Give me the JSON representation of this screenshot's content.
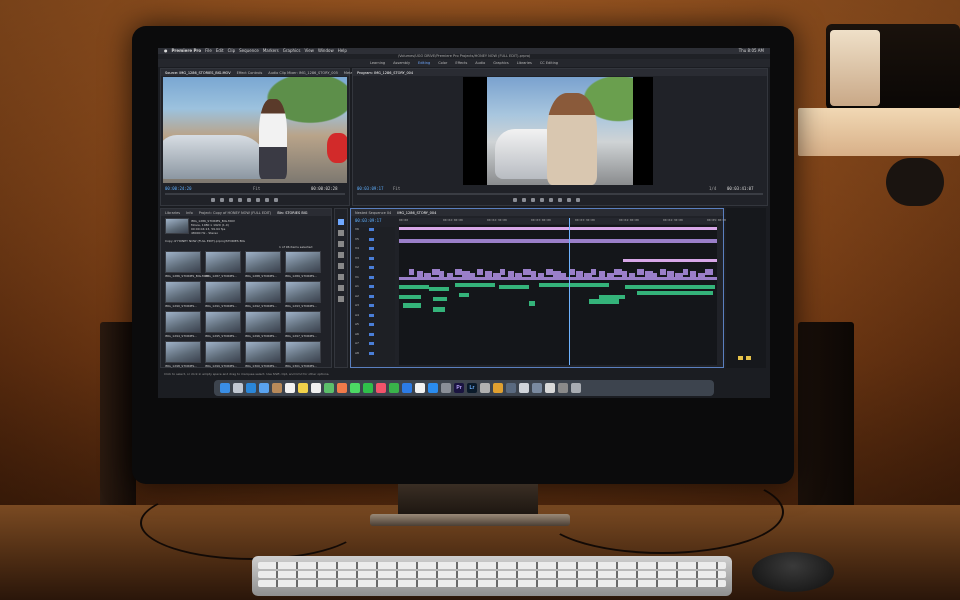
{
  "menubar": {
    "app": "Premiere Pro",
    "items": [
      "File",
      "Edit",
      "Clip",
      "Sequence",
      "Markers",
      "Graphics",
      "View",
      "Window",
      "Help"
    ],
    "clock": "Thu 8:05 AM"
  },
  "window_title": "/Volumes/UGO DRIVE/Premiere Pro Projects/HONEY NOW (FULL EDIT).prproj",
  "workspaces": {
    "items": [
      "Learning",
      "Assembly",
      "Editing",
      "Color",
      "Effects",
      "Audio",
      "Graphics",
      "Libraries",
      "CC Editing"
    ],
    "active": "Editing"
  },
  "source_monitor": {
    "tabs": [
      "Source: IMG_1286_STORIES_BIG.MOV",
      "Effect Controls",
      "Audio Clip Mixer: IMG_1286_STORY_005",
      "Metadata",
      "Audio Track M"
    ],
    "timecode_in": "00:00:24:20",
    "timecode_out": "00:00:02:28",
    "fit": "Fit"
  },
  "program_monitor": {
    "tabs": [
      "Program: IMG_1286_STORY_004"
    ],
    "timecode_in": "00:03:09:17",
    "timecode_out": "00:03:41:07",
    "fit": "Fit",
    "ratio": "1/4"
  },
  "project_panel": {
    "tabs": [
      "Libraries",
      "Info",
      "Project: Copy of HONEY NOW (FULL EDIT)",
      "Bin: STORIES BIG"
    ],
    "clip_info": [
      "IMG_1286_STORIES_BIG.MOV",
      "Movie, 1080 x 1920 (1.0)",
      "00:00:04:13, 59.94 fps",
      "48000 Hz - Stereo"
    ],
    "path": "Copy of HONEY NOW (FULL EDIT).prproj/STORIES BIG",
    "items_selected": "1 of 96 items selected",
    "thumbs": [
      "IMG_1286_STORIES_BIG.MOV",
      "IMG_1287_STORIES...",
      "IMG_1288_STORIES...",
      "IMG_1289_STORIES...",
      "IMG_1290_STORIES...",
      "IMG_1291_STORIES...",
      "IMG_1292_STORIES...",
      "IMG_1293_STORIES...",
      "IMG_1294_STORIES...",
      "IMG_1295_STORIES...",
      "IMG_1296_STORIES...",
      "IMG_1297_STORIES...",
      "IMG_1298_STORIES...",
      "IMG_1299_STORIES...",
      "IMG_1300_STORIES...",
      "IMG_1301_STORIES..."
    ]
  },
  "timeline": {
    "tabs": [
      "Nested Sequence 04",
      "IMG_1286_STORY_004"
    ],
    "timecode": "00:03:09:17",
    "ruler": [
      "00:00",
      "00:02:00:00",
      "00:02:30:00",
      "00:03:00:00",
      "00:03:30:00",
      "00:04:00:00",
      "00:04:30:00",
      "00:05:00:00"
    ],
    "tracks": [
      "V6",
      "V5",
      "V4",
      "V3",
      "V2",
      "V1",
      "A1",
      "A2",
      "A3",
      "A4",
      "A5",
      "A6",
      "A7",
      "A8"
    ]
  },
  "status_bar": "Click to select, or click in empty space and drag to marquee select. Use Shift, Opt, and Cmd for other options.",
  "dock": [
    {
      "name": "finder",
      "color": "#3a8ee6",
      "glyph": ""
    },
    {
      "name": "launchpad",
      "color": "#c0c7d2",
      "glyph": ""
    },
    {
      "name": "safari",
      "color": "#2a86d8",
      "glyph": ""
    },
    {
      "name": "mail",
      "color": "#5aa3f0",
      "glyph": ""
    },
    {
      "name": "contacts",
      "color": "#b88a5a",
      "glyph": ""
    },
    {
      "name": "calendar",
      "color": "#f2f2f2",
      "glyph": ""
    },
    {
      "name": "notes",
      "color": "#f2d24a",
      "glyph": ""
    },
    {
      "name": "reminders",
      "color": "#efefef",
      "glyph": ""
    },
    {
      "name": "maps",
      "color": "#5bbf6a",
      "glyph": ""
    },
    {
      "name": "photos",
      "color": "#f07a4a",
      "glyph": ""
    },
    {
      "name": "messages",
      "color": "#4cd964",
      "glyph": ""
    },
    {
      "name": "facetime",
      "color": "#2fbf4a",
      "glyph": ""
    },
    {
      "name": "music",
      "color": "#f2536a",
      "glyph": ""
    },
    {
      "name": "numbers",
      "color": "#39b34a",
      "glyph": ""
    },
    {
      "name": "keynote",
      "color": "#2c7be5",
      "glyph": ""
    },
    {
      "name": "news",
      "color": "#f2f2f2",
      "glyph": ""
    },
    {
      "name": "app-store",
      "color": "#2a8cf0",
      "glyph": ""
    },
    {
      "name": "system-preferences",
      "color": "#8a8f98",
      "glyph": ""
    },
    {
      "name": "premiere-pro",
      "color": "#1a1440",
      "glyph": "Pr"
    },
    {
      "name": "lightroom",
      "color": "#0a1a2a",
      "glyph": "Lr"
    },
    {
      "name": "photo-app",
      "color": "#b0b0b0",
      "glyph": ""
    },
    {
      "name": "tiles-app",
      "color": "#e0a030",
      "glyph": ""
    },
    {
      "name": "quicktime",
      "color": "#5a6a80",
      "glyph": ""
    },
    {
      "name": "media-player",
      "color": "#d0d4da",
      "glyph": ""
    },
    {
      "name": "image-capture",
      "color": "#7a8aa0",
      "glyph": ""
    },
    {
      "name": "documents-folder",
      "color": "#d8d8d8",
      "glyph": ""
    },
    {
      "name": "downloads-stack",
      "color": "#8a8a8a",
      "glyph": ""
    },
    {
      "name": "trash",
      "color": "#a8acb2",
      "glyph": ""
    }
  ],
  "colors": {
    "accent_blue": "#5fb0ff",
    "video_clip": "#9a7fc9",
    "audio_clip": "#34b37a",
    "wall_orange": "#b06a2a"
  }
}
